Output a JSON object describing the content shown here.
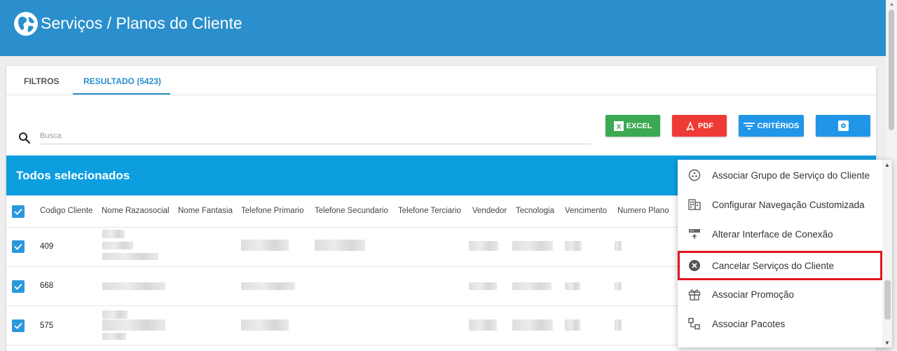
{
  "header": {
    "title": "Serviços / Planos do Cliente",
    "logo_icon": "globe-icon"
  },
  "tabs": [
    {
      "label": "FILTROS",
      "active": false
    },
    {
      "label": "RESULTADO (5423)",
      "active": true
    }
  ],
  "search": {
    "placeholder": "Busca",
    "value": "",
    "icon": "search-icon"
  },
  "toolbar": {
    "excel_label": "EXCEL",
    "pdf_label": "PDF",
    "criterios_label": "CRITÉRIOS",
    "settings_icon": "gear-icon"
  },
  "banner": {
    "text": "Todos selecionados"
  },
  "table": {
    "columns": [
      "Codigo Cliente",
      "Nome Razaosocial",
      "Nome Fantasia",
      "Telefone Primario",
      "Telefone Secundario",
      "Telefone Terciario",
      "Vendedor",
      "Tecnologia",
      "Vencimento",
      "Numero Plano"
    ],
    "rows": [
      {
        "codigo": "409",
        "checked": true
      },
      {
        "codigo": "668",
        "checked": true
      },
      {
        "codigo": "575",
        "checked": true
      }
    ]
  },
  "context_menu": {
    "items": [
      {
        "label": "Associar Grupo de Serviço do Cliente",
        "icon": "group-icon"
      },
      {
        "label": "Configurar Navegação Customizada",
        "icon": "building-icon"
      },
      {
        "label": "Alterar Interface de Conexão",
        "icon": "network-interface-icon"
      },
      {
        "label": "Cancelar Serviços do Cliente",
        "icon": "cancel-icon",
        "highlighted": true
      },
      {
        "label": "Associar Promoção",
        "icon": "gift-icon"
      },
      {
        "label": "Associar Pacotes",
        "icon": "packages-icon"
      }
    ]
  },
  "colors": {
    "header": "#2a8fcc",
    "banner": "#0d9ee0",
    "excel": "#3aa952",
    "pdf": "#ef3b35",
    "primary": "#2196e8",
    "highlight_border": "#e01820"
  }
}
